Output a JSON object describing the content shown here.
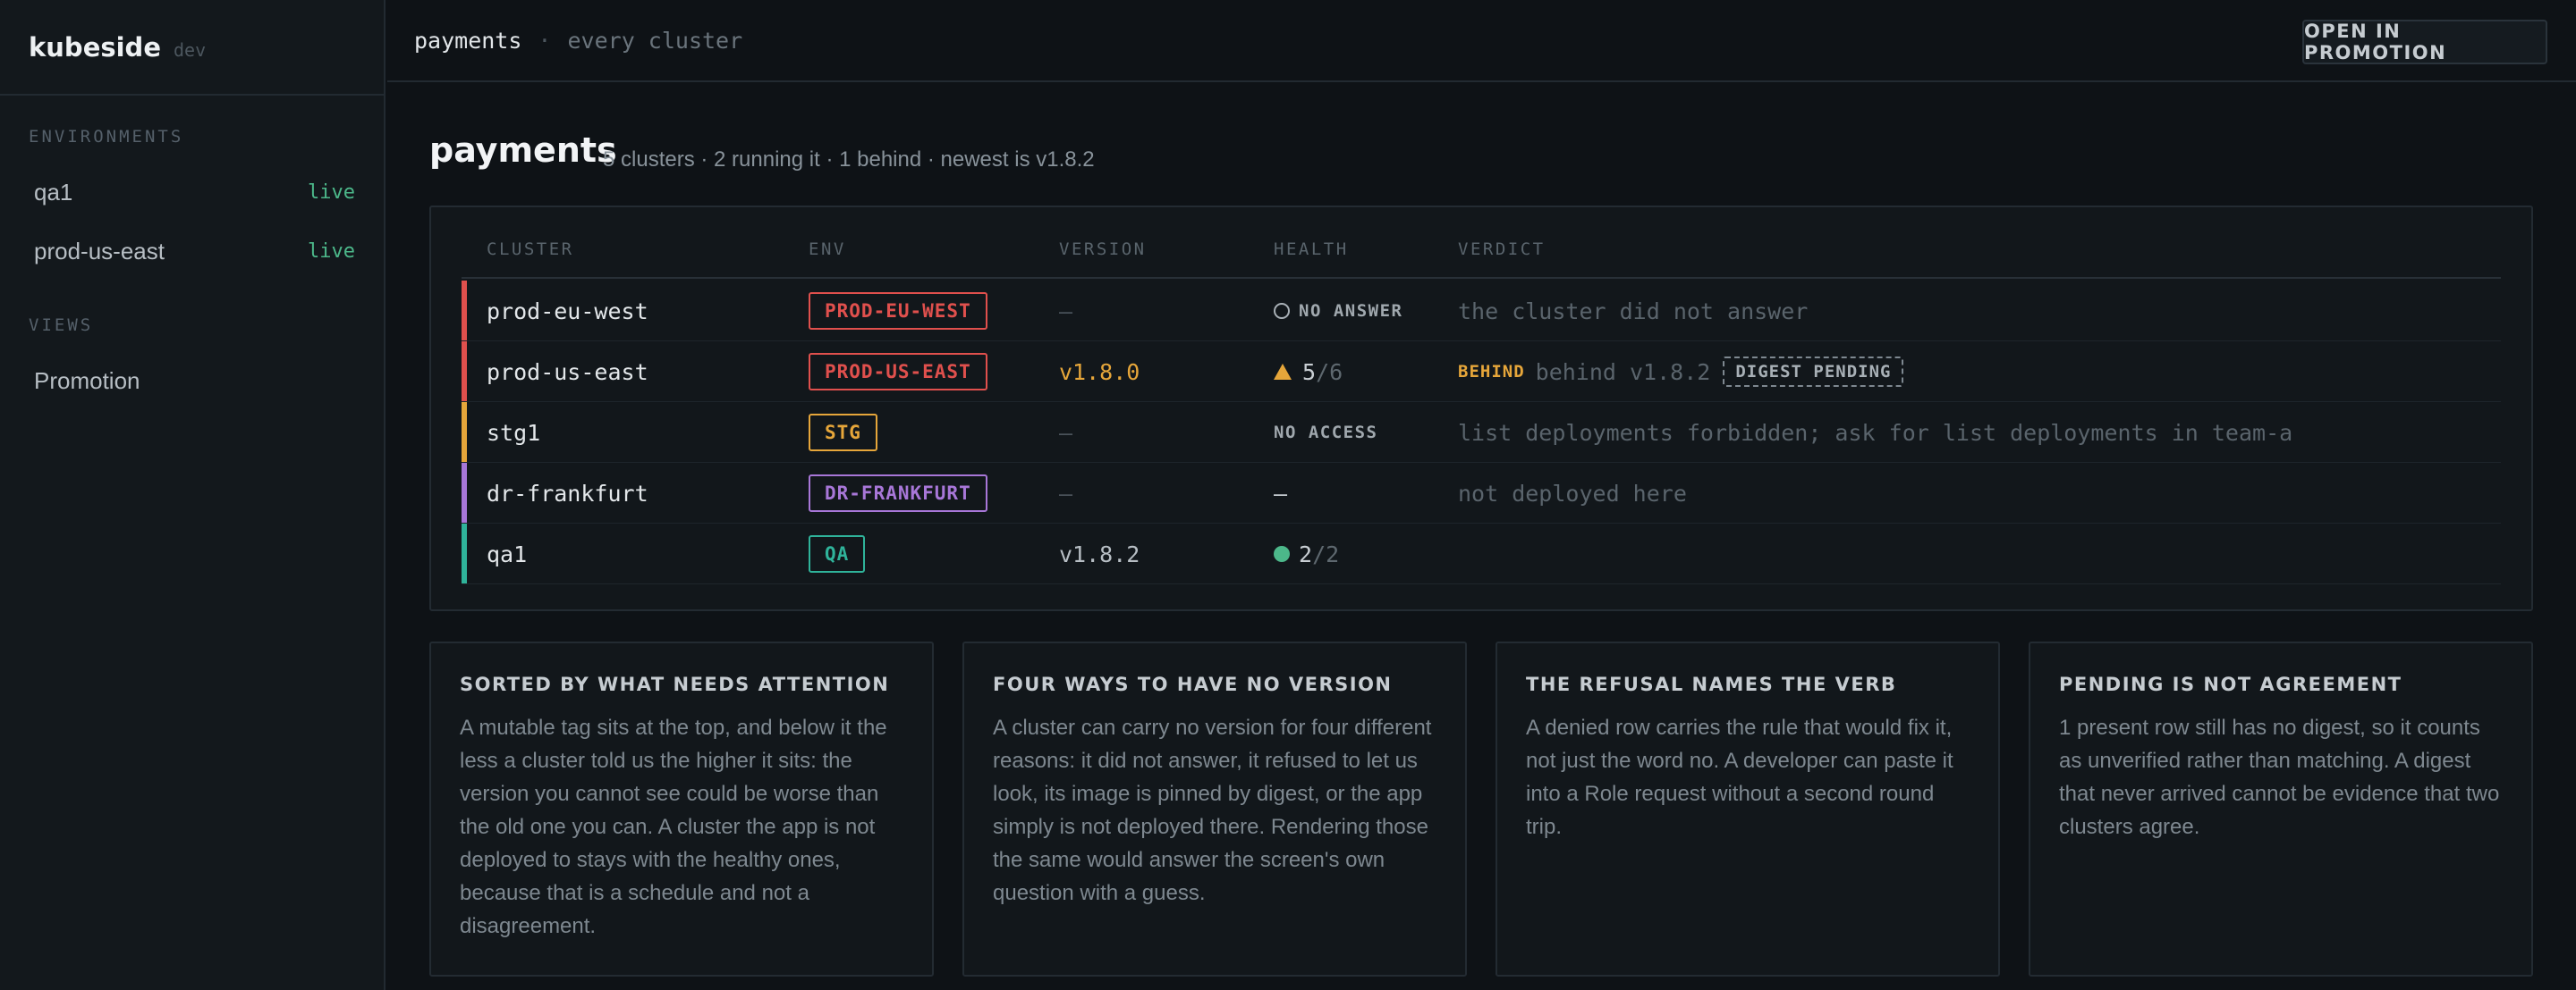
{
  "app": {
    "name": "kubeside",
    "env_tag": "dev"
  },
  "sidebar": {
    "environments_label": "ENVIRONMENTS",
    "environments": [
      {
        "label": "qa1",
        "status": "live"
      },
      {
        "label": "prod-us-east",
        "status": "live"
      }
    ],
    "views_label": "VIEWS",
    "views": [
      {
        "label": "Promotion"
      }
    ]
  },
  "topbar": {
    "app": "payments",
    "separator": "·",
    "scope": "every cluster",
    "open_button": "OPEN IN PROMOTION"
  },
  "page": {
    "title": "payments",
    "summary": "5 clusters · 2 running it · 1 behind · newest is v1.8.2"
  },
  "table": {
    "columns": {
      "cluster": "CLUSTER",
      "env": "ENV",
      "version": "VERSION",
      "health": "HEALTH",
      "verdict": "VERDICT"
    },
    "rows": [
      {
        "cluster": "prod-eu-west",
        "env": "PROD-EU-WEST",
        "env_color": "#e0504d",
        "version": "—",
        "health_icon": "circle-outline-icon",
        "health_text": "NO ANSWER",
        "verdict": "the cluster did not answer"
      },
      {
        "cluster": "prod-us-east",
        "env": "PROD-US-EAST",
        "env_color": "#e0504d",
        "version": "v1.8.0",
        "version_color": "#e6a63a",
        "health_icon": "warning-triangle-icon",
        "health_count": "5",
        "health_total": "/6",
        "verdict_tag": "BEHIND",
        "verdict": "behind v1.8.2",
        "verdict_badge": "DIGEST PENDING"
      },
      {
        "cluster": "stg1",
        "env": "STG",
        "env_color": "#e6a63a",
        "version": "—",
        "health_text": "NO ACCESS",
        "verdict": "list deployments forbidden; ask for list deployments in team-a"
      },
      {
        "cluster": "dr-frankfurt",
        "env": "DR-FRANKFURT",
        "env_color": "#a877d8",
        "version": "—",
        "health_text": "—",
        "verdict": "not deployed here"
      },
      {
        "cluster": "qa1",
        "env": "QA",
        "env_color": "#2fb39a",
        "version": "v1.8.2",
        "version_color": "#b7bec4",
        "health_icon": "healthy-dot-icon",
        "health_count": "2",
        "health_total": "/2",
        "verdict": ""
      }
    ]
  },
  "cards": [
    {
      "title": "SORTED BY WHAT NEEDS ATTENTION",
      "body": "A mutable tag sits at the top, and below it the less a cluster told us the higher it sits: the version you cannot see could be worse than the old one you can. A cluster the app is not deployed to stays with the healthy ones, because that is a schedule and not a disagreement."
    },
    {
      "title": "FOUR WAYS TO HAVE NO VERSION",
      "body": "A cluster can carry no version for four different reasons: it did not answer, it refused to let us look, its image is pinned by digest, or the app simply is not deployed there. Rendering those the same would answer the screen's own question with a guess."
    },
    {
      "title": "THE REFUSAL NAMES THE VERB",
      "body": "A denied row carries the rule that would fix it, not just the word no. A developer can paste it into a Role request without a second round trip."
    },
    {
      "title": "PENDING IS NOT AGREEMENT",
      "body": "1 present row still has no digest, so it counts as unverified rather than matching. A digest that never arrived cannot be evidence that two clusters agree."
    }
  ]
}
